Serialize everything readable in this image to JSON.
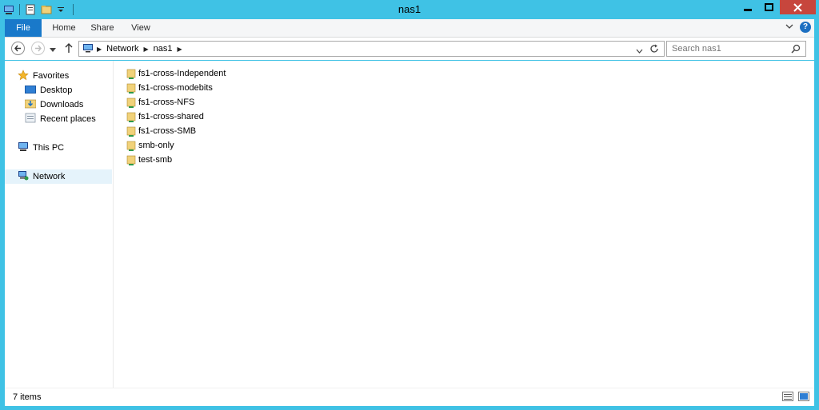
{
  "window": {
    "title": "nas1"
  },
  "ribbon": {
    "tabs": [
      "File",
      "Home",
      "Share",
      "View"
    ]
  },
  "address": {
    "path": [
      "Network",
      "nas1"
    ],
    "search_placeholder": "Search nas1"
  },
  "navigation": {
    "favorites_label": "Favorites",
    "favorites": [
      "Desktop",
      "Downloads",
      "Recent places"
    ],
    "this_pc_label": "This PC",
    "network_label": "Network"
  },
  "files": [
    "fs1-cross-Independent",
    "fs1-cross-modebits",
    "fs1-cross-NFS",
    "fs1-cross-shared",
    "fs1-cross-SMB",
    "smb-only",
    "test-smb"
  ],
  "status": {
    "item_count": "7 items"
  },
  "colors": {
    "titlebar": "#3fc2e5",
    "file_tab": "#1979ca",
    "close_button": "#c7463d",
    "selection": "#e5f3fb"
  },
  "icons": {
    "share_folder": "shared-folder-icon",
    "favorites": "star-icon",
    "network": "network-icon",
    "this_pc": "computer-icon"
  }
}
